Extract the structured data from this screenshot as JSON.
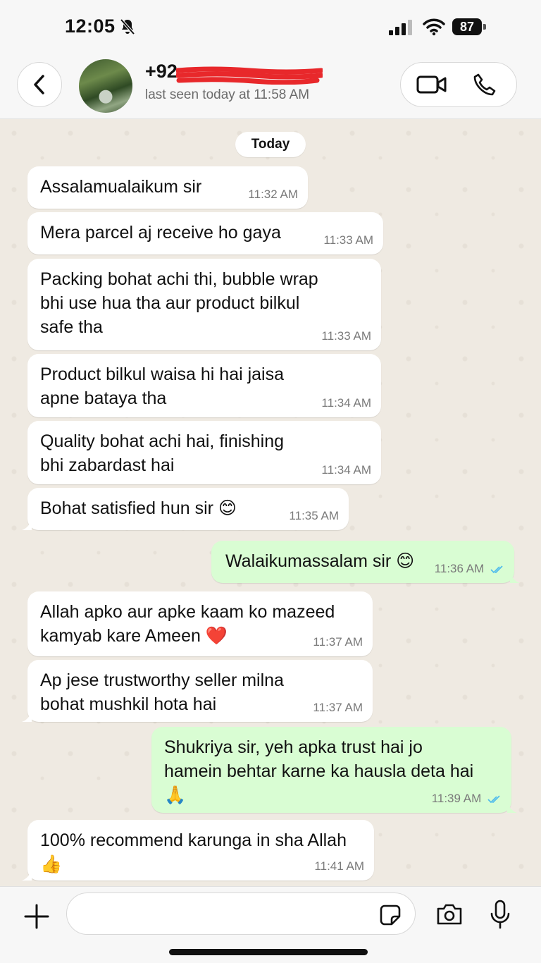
{
  "status_bar": {
    "time": "12:05",
    "battery": "87"
  },
  "header": {
    "contact_name": "+92",
    "last_seen": "last seen today at 11:58 AM"
  },
  "chat": {
    "date_chip": "Today",
    "messages": [
      {
        "dir": "in",
        "text": "Assalamualaikum sir",
        "time": "11:32 AM"
      },
      {
        "dir": "in",
        "text": "Mera parcel aj receive ho gaya",
        "time": "11:33 AM"
      },
      {
        "dir": "in",
        "text": "Packing bohat achi thi, bubble wrap\nbhi use hua tha aur product bilkul\nsafe tha",
        "time": "11:33 AM"
      },
      {
        "dir": "in",
        "text": "Product bilkul waisa hi hai jaisa\napne bataya tha",
        "time": "11:34 AM"
      },
      {
        "dir": "in",
        "text": "Quality bohat achi hai, finishing\nbhi zabardast hai",
        "time": "11:34 AM"
      },
      {
        "dir": "in",
        "text": "Bohat satisfied hun sir 😊",
        "time": "11:35 AM"
      },
      {
        "dir": "out",
        "text": "Walaikumassalam sir 😊",
        "time": "11:36 AM"
      },
      {
        "dir": "in",
        "text": "Allah apko aur apke kaam ko mazeed\nkamyab kare Ameen ❤️",
        "time": "11:37 AM"
      },
      {
        "dir": "in",
        "text": "Ap jese trustworthy seller milna\nbohat mushkil hota hai",
        "time": "11:37 AM"
      },
      {
        "dir": "out",
        "text": "Shukriya sir, yeh apka trust hai jo\nhamein behtar karne ka hausla deta hai\n🙏",
        "time": "11:39 AM"
      },
      {
        "dir": "in",
        "text": "100% recommend karunga in sha Allah\n👍",
        "time": "11:41 AM"
      }
    ]
  },
  "input": {
    "placeholder": ""
  },
  "colors": {
    "incoming": "#ffffff",
    "outgoing": "#d9fdd3",
    "read_ticks": "#53bdeb",
    "background": "#efeae2"
  },
  "icons": [
    "back-chevron-icon",
    "video-call-icon",
    "phone-call-icon",
    "plus-icon",
    "sticker-icon",
    "camera-icon",
    "mic-icon",
    "bell-slash-icon",
    "signal-icon",
    "wifi-icon",
    "battery-icon",
    "read-ticks-icon"
  ]
}
